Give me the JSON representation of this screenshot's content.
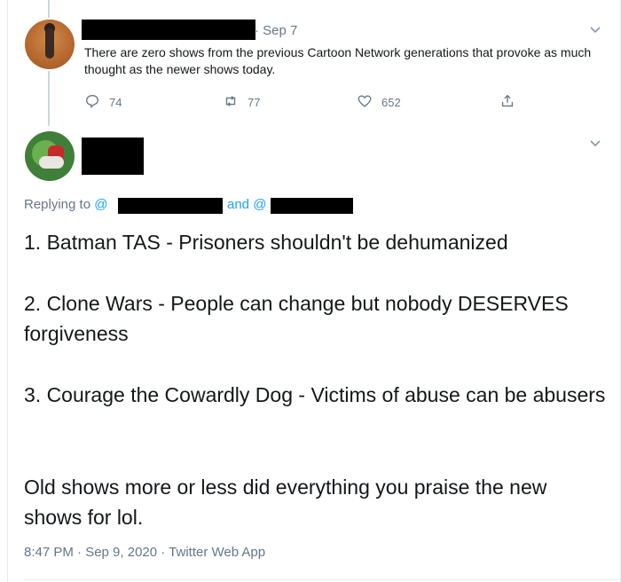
{
  "parent_tweet": {
    "date": "· Sep 7",
    "text": "There are zero shows from the previous Cartoon Network generations that provoke as much thought as the newer shows today.",
    "reply_count": "74",
    "retweet_count": "77",
    "like_count": "652",
    "icons": [
      "reply-icon",
      "retweet-icon",
      "like-icon",
      "share-icon",
      "chevron-down-icon"
    ]
  },
  "reply_tweet": {
    "replying_prefix": "Replying to",
    "at1": "@",
    "and_text": "and @",
    "lines": [
      "1. Batman TAS - Prisoners shouldn't be dehumanized",
      "2. Clone Wars - People can change but nobody DESERVES forgiveness",
      "3. Courage the Cowardly Dog - Victims of abuse can be abusers",
      "Old shows more or less did everything you praise the new shows for lol."
    ],
    "timestamp": "8:47 PM · Sep 9, 2020 · Twitter Web App"
  },
  "colors": {
    "text": "#14171a",
    "secondary": "#657786",
    "link": "#1da1f2",
    "divider": "#e6ecf0",
    "redaction": "#000000"
  }
}
